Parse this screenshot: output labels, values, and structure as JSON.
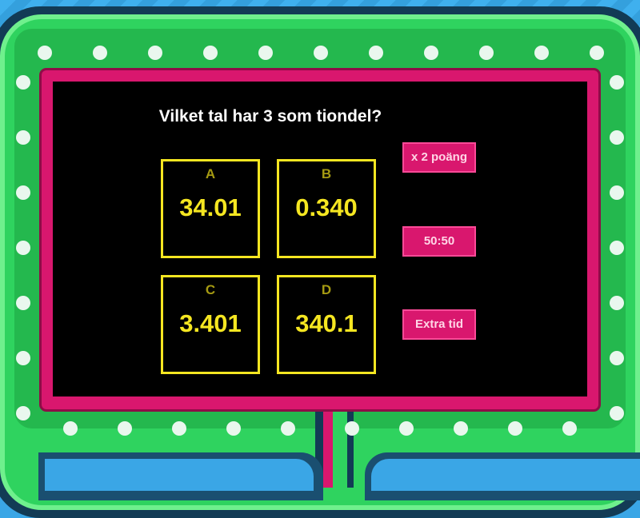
{
  "question": "Vilket tal har 3 som tiondel?",
  "answers": [
    {
      "letter": "A",
      "value": "34.01"
    },
    {
      "letter": "B",
      "value": "0.340"
    },
    {
      "letter": "C",
      "value": "3.401"
    },
    {
      "letter": "D",
      "value": "340.1"
    }
  ],
  "powerups": [
    {
      "label": "x 2 poäng"
    },
    {
      "label": "50:50"
    },
    {
      "label": "Extra tid"
    }
  ],
  "colors": {
    "background": "#3aa6e6",
    "frame_green": "#2fd35f",
    "frame_pink": "#d9176e",
    "answer_accent": "#f5e621",
    "screen": "#000000"
  }
}
